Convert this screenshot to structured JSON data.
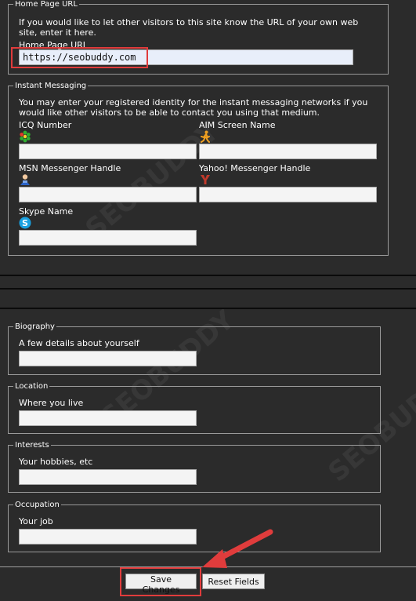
{
  "homepage": {
    "legend": "Home Page URL",
    "description": "If you would like to let other visitors to this site know the URL of your own web site, enter it here.",
    "field_label": "Home Page URL",
    "value": "https://seobuddy.com"
  },
  "im": {
    "legend": "Instant Messaging",
    "description": "You may enter your registered identity for the instant messaging networks if you would like other visitors to be able to contact you using that medium.",
    "icq_label": "ICQ Number",
    "aim_label": "AIM Screen Name",
    "msn_label": "MSN Messenger Handle",
    "yahoo_label": "Yahoo! Messenger Handle",
    "skype_label": "Skype Name"
  },
  "biography": {
    "legend": "Biography",
    "label": "A few details about yourself"
  },
  "location": {
    "legend": "Location",
    "label": "Where you live"
  },
  "interests": {
    "legend": "Interests",
    "label": "Your hobbies, etc"
  },
  "occupation": {
    "legend": "Occupation",
    "label": "Your job"
  },
  "buttons": {
    "save": "Save Changes",
    "reset": "Reset Fields"
  },
  "watermark": "SEOBUDDY",
  "colors": {
    "background": "#2b2b2b",
    "highlight": "#e03c3c",
    "field_bg": "#f4f4f4",
    "url_field_bg": "#e8eefa"
  }
}
